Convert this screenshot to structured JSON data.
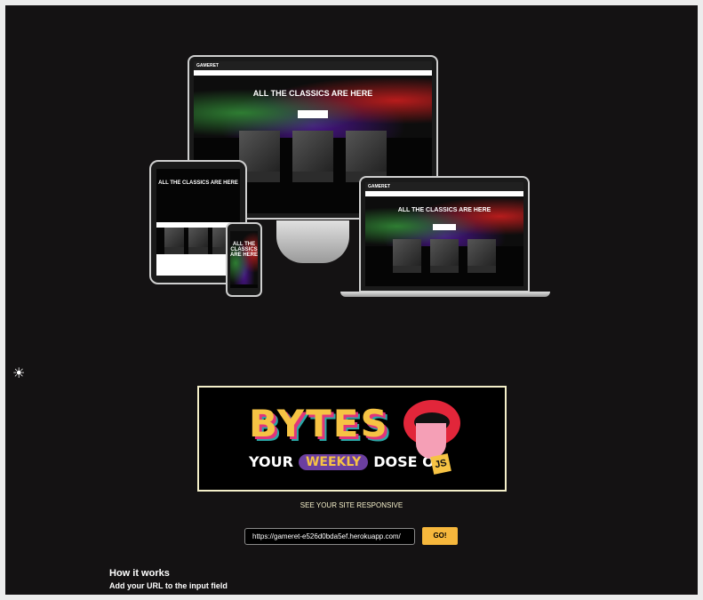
{
  "mockup": {
    "desktop": {
      "brand": "GAMERET",
      "hero_title": "ALL THE CLASSICS ARE HERE"
    },
    "laptop": {
      "brand": "GAMERET",
      "hero_title": "ALL THE CLASSICS ARE HERE"
    },
    "tablet": {
      "hero_title": "ALL THE CLASSICS ARE HERE"
    },
    "phone": {
      "hero_title": "ALL THE CLASSICS ARE HERE"
    }
  },
  "theme_toggle": {
    "icon": "sun-icon",
    "glyph": "☀"
  },
  "banner": {
    "title": "BYTES",
    "tagline_before": "YOUR",
    "tagline_highlight": "WEEKLY",
    "tagline_after": "DOSE OF",
    "badge": "JS"
  },
  "subtitle": "SEE YOUR SITE RESPONSIVE",
  "url_input": {
    "value": "https://gameret-e526d0bda5ef.herokuapp.com/"
  },
  "go_button": {
    "label": "GO!"
  },
  "how": {
    "title": "How it works",
    "text": "Add your URL to the input field"
  },
  "colors": {
    "background": "#141213",
    "accent": "#f6b73c",
    "cream": "#f4efc9"
  }
}
